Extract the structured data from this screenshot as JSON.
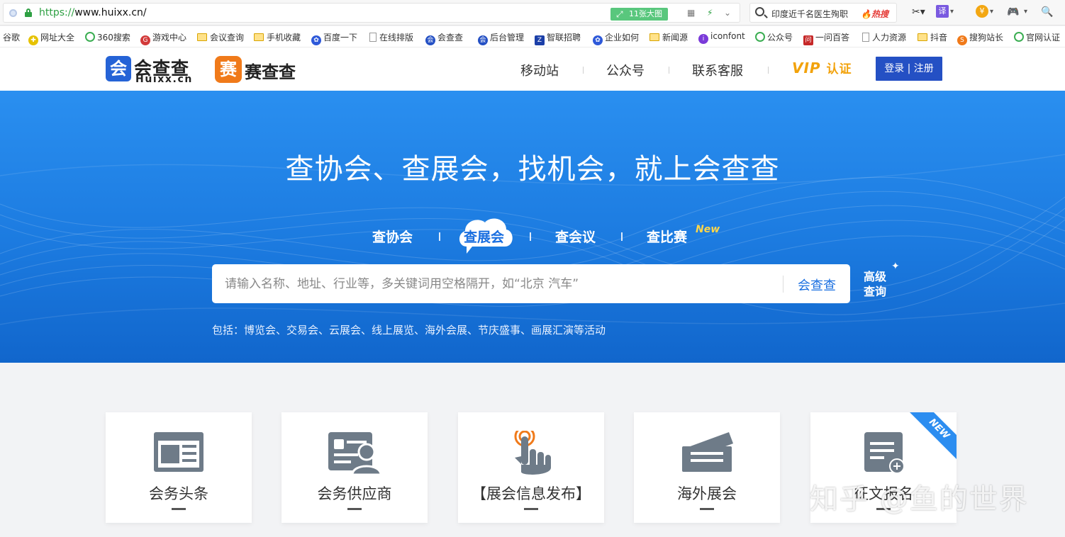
{
  "browser": {
    "url_scheme": "https://",
    "url_rest": "www.huixx.cn/",
    "image_badge": "11张大图",
    "hot_query": "印度近千名医生殉职",
    "hot_tag": "热搜"
  },
  "bookmarks": [
    {
      "label": "谷歌",
      "icon": "none"
    },
    {
      "label": "网址大全",
      "icon": "site-icon"
    },
    {
      "label": "360搜索",
      "icon": "search-engine-icon"
    },
    {
      "label": "游戏中心",
      "icon": "game-icon"
    },
    {
      "label": "会议查询",
      "icon": "folder-icon"
    },
    {
      "label": "手机收藏",
      "icon": "folder-icon"
    },
    {
      "label": "百度一下",
      "icon": "paw-icon"
    },
    {
      "label": "在线排版",
      "icon": "document-icon"
    },
    {
      "label": "会查查",
      "icon": "site-icon"
    },
    {
      "label": "后台管理",
      "icon": "site-icon"
    },
    {
      "label": "智联招聘",
      "icon": "site-icon"
    },
    {
      "label": "企业如何",
      "icon": "paw-icon"
    },
    {
      "label": "新闻源",
      "icon": "folder-icon"
    },
    {
      "label": "iconfont",
      "icon": "site-icon"
    },
    {
      "label": "公众号",
      "icon": "site-icon"
    },
    {
      "label": "一问百答",
      "icon": "site-icon"
    },
    {
      "label": "人力资源",
      "icon": "document-icon"
    },
    {
      "label": "抖音",
      "icon": "folder-icon"
    },
    {
      "label": "搜狗站长",
      "icon": "site-icon"
    },
    {
      "label": "官网认证",
      "icon": "search-engine-icon"
    }
  ],
  "header": {
    "logo_main": "会查查",
    "logo_main_mark": "会",
    "logo_main_sub": "Huixx.cn",
    "logo_second_mark": "赛",
    "logo_second": "赛查查",
    "nav": [
      "移动站",
      "公众号",
      "联系客服"
    ],
    "vip_label": "VIP",
    "vip_cn": "认证",
    "login": "登录 | 注册"
  },
  "hero": {
    "title": "查协会、查展会，找机会，就上会查查",
    "tabs": [
      "查协会",
      "查展会",
      "查会议",
      "查比赛"
    ],
    "active_tab": "查展会",
    "new_tag": "New",
    "search_placeholder": "请输入名称、地址、行业等，多关键词用空格隔开，如“北京 汽车”",
    "search_button": "会查查",
    "advanced_line1": "高级",
    "advanced_line2": "查询",
    "includes": "包括：博览会、交易会、云展会、线上展览、海外会展、节庆盛事、画展汇演等活动"
  },
  "cards": [
    {
      "label": "会务头条",
      "icon": "newspaper-icon"
    },
    {
      "label": "会务供应商",
      "icon": "id-card-icon"
    },
    {
      "label": "【展会信息发布】",
      "icon": "touch-icon"
    },
    {
      "label": "海外展会",
      "icon": "tickets-icon"
    },
    {
      "label": "征文报名",
      "icon": "form-add-icon",
      "badge": "NEW"
    }
  ],
  "watermark": "知乎 @鱼的世界",
  "colors": {
    "brand_blue": "#2450c4",
    "hero_blue": "#1c7be0",
    "vip_gold": "#f2a20b",
    "logo_orange": "#f07a1a"
  }
}
